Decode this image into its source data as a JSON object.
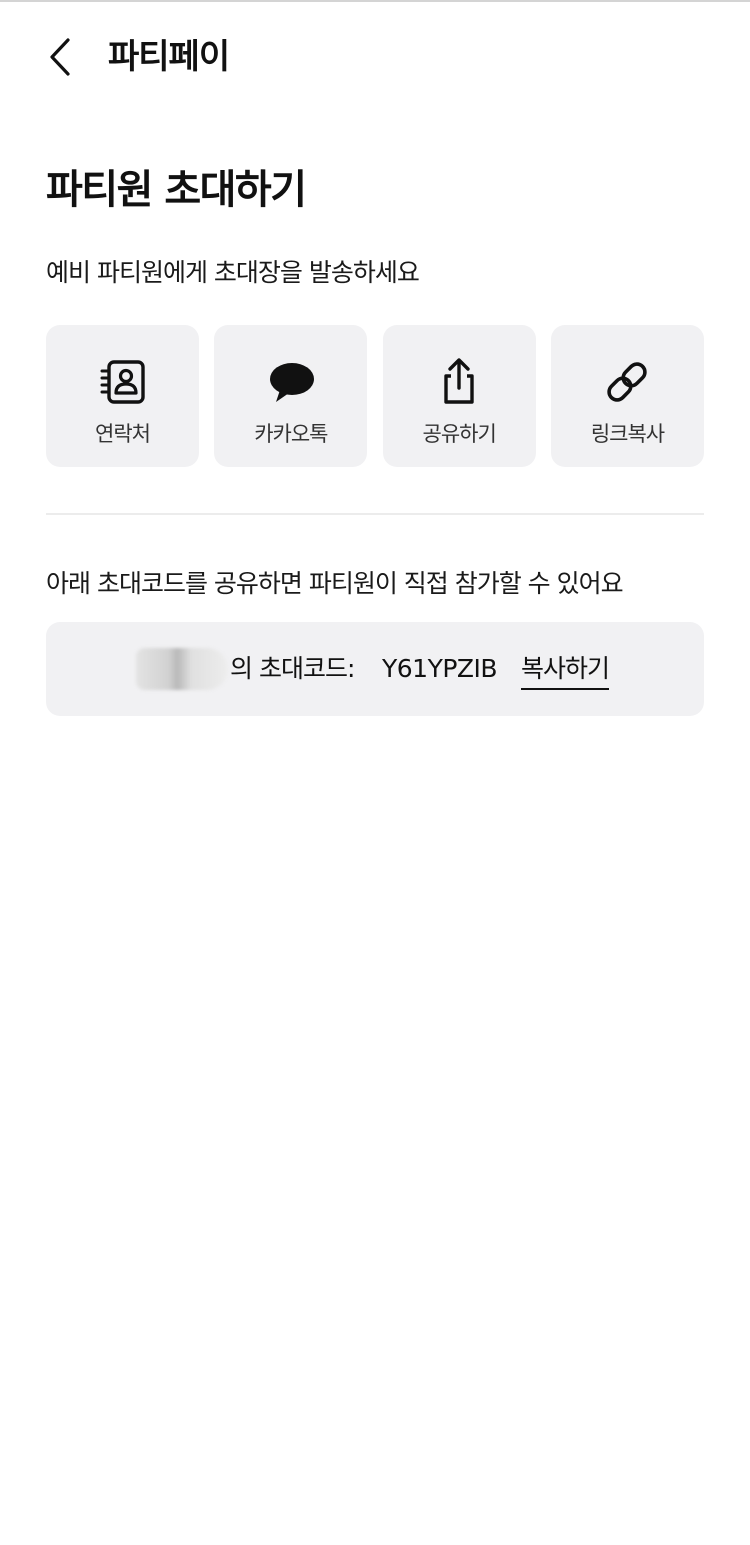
{
  "header": {
    "title": "파티페이",
    "back_icon": "chevron-left-icon"
  },
  "page_title": "파티원 초대하기",
  "subtitle": "예비 파티원에게 초대장을 발송하세요",
  "share_options": [
    {
      "label": "연락처",
      "icon": "contact-book-icon"
    },
    {
      "label": "카카오톡",
      "icon": "kakaotalk-icon"
    },
    {
      "label": "공유하기",
      "icon": "share-icon"
    },
    {
      "label": "링크복사",
      "icon": "link-icon"
    }
  ],
  "invite_code": {
    "description": "아래 초대코드를 공유하면 파티원이 직접 참가할 수 있어요",
    "label": "의 초대코드:",
    "code": "Y61YPZIB",
    "copy_label": "복사하기"
  },
  "colors": {
    "tile_background": "#f1f1f3",
    "text": "#111111",
    "divider": "#ececec"
  }
}
